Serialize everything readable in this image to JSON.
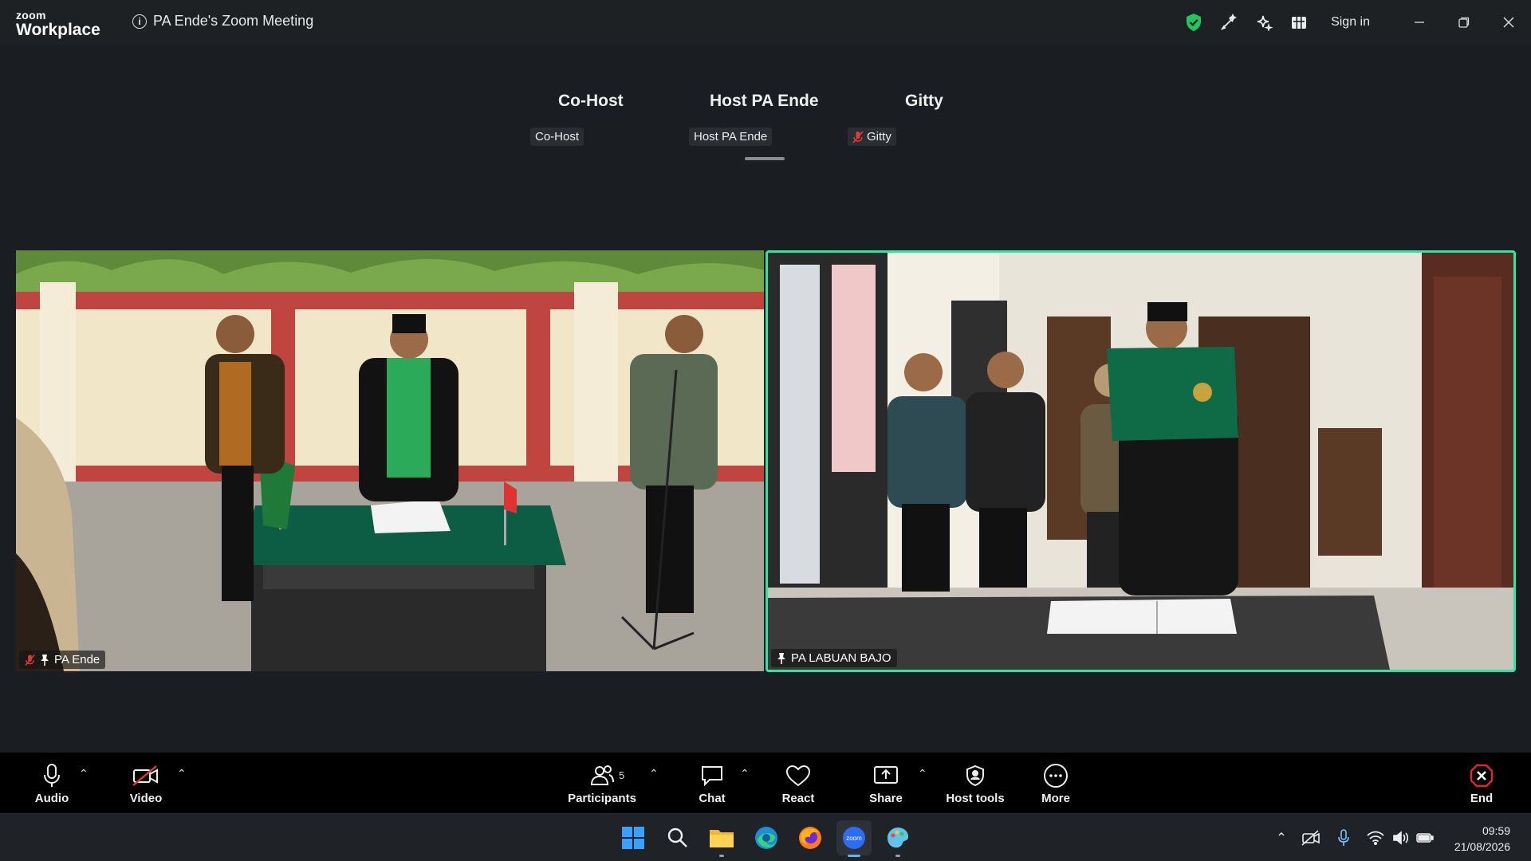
{
  "app": {
    "logo_line1": "zoom",
    "logo_line2": "Workplace",
    "meeting_title": "PA Ende's Zoom Meeting",
    "sign_in": "Sign in",
    "icons": [
      "shield-check-icon",
      "annotate-icon",
      "ai-companion-icon",
      "apps-grid-icon"
    ],
    "window_buttons": [
      "minimize-icon",
      "restore-icon",
      "close-icon"
    ]
  },
  "speakers": [
    {
      "name": "Co-Host",
      "tag": "Co-Host",
      "muted": false
    },
    {
      "name": "Host PA Ende",
      "tag": "Host PA Ende",
      "muted": false,
      "active": true
    },
    {
      "name": "Gitty",
      "tag": "Gitty",
      "muted": true
    }
  ],
  "videos": [
    {
      "name": "PA Ende",
      "muted": true,
      "pinned": true,
      "active": false
    },
    {
      "name": "PA LABUAN BAJO",
      "muted": false,
      "pinned": true,
      "active": true
    }
  ],
  "controls": {
    "audio": "Audio",
    "video": "Video",
    "participants": "Participants",
    "participants_count": "5",
    "chat": "Chat",
    "react": "React",
    "share": "Share",
    "host_tools": "Host tools",
    "more": "More",
    "end": "End"
  },
  "taskbar": {
    "apps": [
      "windows-start-icon",
      "search-icon",
      "file-explorer-icon",
      "edge-browser-icon",
      "firefox-icon",
      "zoom-app-icon",
      "paint-icon"
    ],
    "zoom_label": "zoom",
    "time": "09:59",
    "date": "21/08/2026"
  },
  "colors": {
    "active_speaker_border": "#2ee6a0",
    "end_red": "#e02828",
    "shield_green": "#22c55e"
  }
}
